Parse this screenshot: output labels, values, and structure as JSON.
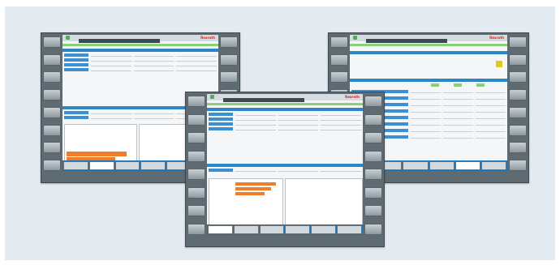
{
  "screens": [
    {
      "id": "left",
      "brand": "Rexroth"
    },
    {
      "id": "right",
      "brand": "Rexroth"
    },
    {
      "id": "center",
      "brand": "Rexroth"
    }
  ],
  "colors": {
    "background_panel": "#e4ebf0",
    "screen_frame": "#5f6b72",
    "accent_blue": "#2f86c6",
    "accent_green": "#8ccf7a",
    "chart_orange": "#f07d2a",
    "brand_red": "#d22"
  }
}
